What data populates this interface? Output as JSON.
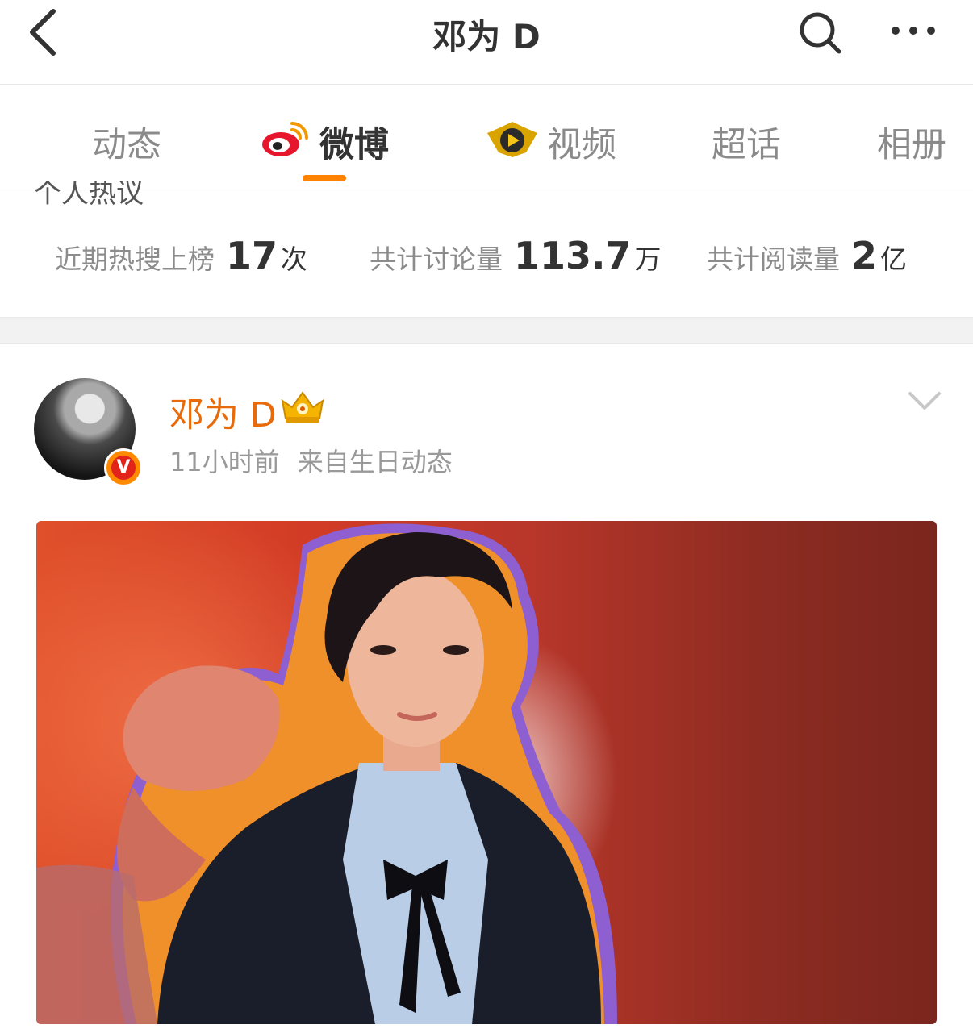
{
  "header": {
    "title": "邓为 D",
    "back_icon": "chevron-left-icon",
    "search_icon": "search-icon",
    "more_icon": "more-dots-icon"
  },
  "tabs": [
    {
      "label": "动态",
      "active": false
    },
    {
      "label": "微博",
      "active": true,
      "icon": "weibo-logo-icon"
    },
    {
      "label": "视频",
      "active": false,
      "icon": "video-play-badge-icon"
    },
    {
      "label": "超话",
      "active": false
    },
    {
      "label": "相册",
      "active": false
    }
  ],
  "section_title_partial": "个人热议",
  "stats": [
    {
      "label": "近期热搜上榜",
      "value": "17",
      "unit": "次"
    },
    {
      "label": "共计讨论量",
      "value": "113.7",
      "unit": "万"
    },
    {
      "label": "共计阅读量",
      "value": "2",
      "unit": "亿"
    }
  ],
  "post": {
    "author": "邓为 D",
    "time": "11小时前",
    "source": "来自生日动态",
    "verified_badge": "V",
    "badge_icon": "crown-member-icon",
    "menu_icon": "chevron-down-icon"
  },
  "colors": {
    "accent": "#ff8200",
    "username": "#e86b0b",
    "label_gray": "#8c8c8c",
    "divider": "#f2f2f2"
  }
}
